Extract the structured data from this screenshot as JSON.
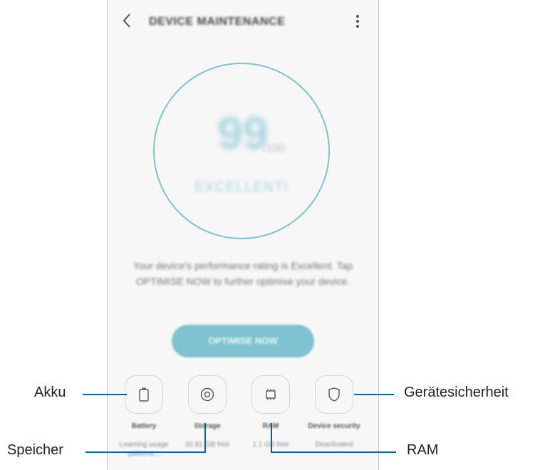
{
  "header": {
    "title": "DEVICE MAINTENANCE",
    "back_icon": "chevron-left-icon",
    "menu_icon": "more-vertical-icon"
  },
  "score": {
    "value": "99",
    "unit": "/100",
    "rating": "EXCELLENT!"
  },
  "description": "Your device's performance rating is Excellent. Tap OPTIMISE NOW to further optimise your device.",
  "optimise_button": "OPTIMISE NOW",
  "features": [
    {
      "label": "Battery",
      "sub": "Learning usage patterns...",
      "icon": "battery-icon"
    },
    {
      "label": "Storage",
      "sub": "32.81 GB free",
      "icon": "storage-icon"
    },
    {
      "label": "RAM",
      "sub": "1.1 GB free",
      "icon": "memory-chip-icon"
    },
    {
      "label": "Device security",
      "sub": "Deactivated",
      "icon": "shield-icon"
    }
  ],
  "callouts": {
    "battery": "Akku",
    "storage": "Speicher",
    "ram": "RAM",
    "security": "Gerätesicherheit"
  },
  "colors": {
    "accent": "#7ec3cf",
    "callout_line": "#0b5fa5"
  }
}
